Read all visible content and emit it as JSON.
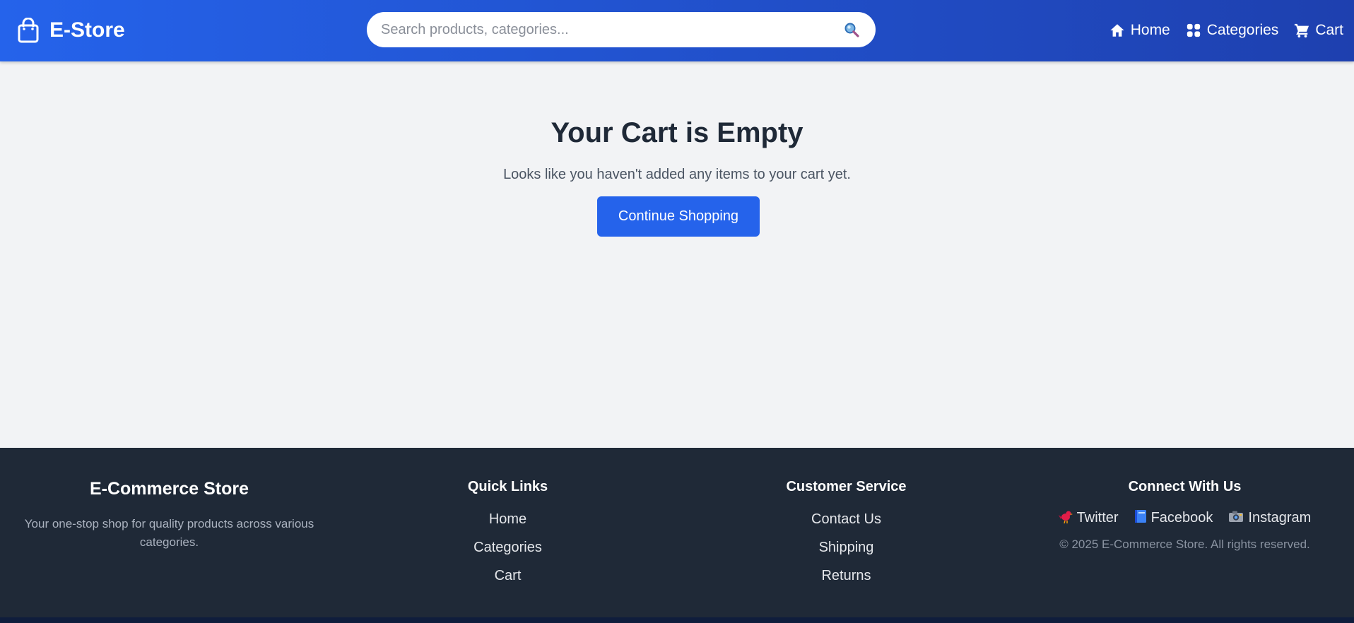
{
  "header": {
    "logo_text": "E-Store",
    "search": {
      "placeholder": "Search products, categories..."
    },
    "nav": [
      {
        "label": "Home",
        "icon": "home-icon"
      },
      {
        "label": "Categories",
        "icon": "grid-icon"
      },
      {
        "label": "Cart",
        "icon": "cart-icon"
      }
    ],
    "colors": {
      "gradient_start": "#2563eb",
      "gradient_end": "#1e40af"
    }
  },
  "main": {
    "title": "Your Cart is Empty",
    "subtitle": "Looks like you haven't added any items to your cart yet.",
    "cta_label": "Continue Shopping",
    "cta_color": "#2563eb"
  },
  "footer": {
    "brand": {
      "title": "E-Commerce Store",
      "description": "Your one-stop shop for quality products across various categories."
    },
    "quick_links": {
      "heading": "Quick Links",
      "items": [
        "Home",
        "Categories",
        "Cart"
      ]
    },
    "customer_service": {
      "heading": "Customer Service",
      "items": [
        "Contact Us",
        "Shipping",
        "Returns"
      ]
    },
    "connect": {
      "heading": "Connect With Us",
      "social": [
        {
          "label": "Twitter",
          "icon": "bird-icon"
        },
        {
          "label": "Facebook",
          "icon": "book-icon"
        },
        {
          "label": "Instagram",
          "icon": "camera-icon"
        }
      ],
      "copyright": "© 2025 E-Commerce Store. All rights reserved."
    },
    "background": "#1f2937"
  }
}
